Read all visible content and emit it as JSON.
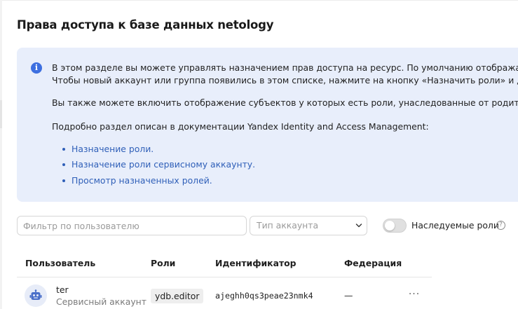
{
  "page": {
    "title": "Права доступа к базе данных netology"
  },
  "info": {
    "line1": "В этом разделе вы можете управлять назначением прав доступа на ресурс. По умолчанию отображается список",
    "line2": "Чтобы новый аккаунт или группа появились в этом списке, нажмите на кнопку «Назначить роли» и добавьте с",
    "line3": "Вы также можете включить отображение субъектов у которых есть роли, унаследованные от родительских ре",
    "line4": "Подробно раздел описан в документации Yandex Identity and Access Management:",
    "links": [
      "Назначение роли.",
      "Назначение роли сервисному аккаунту.",
      "Просмотр назначенных ролей."
    ]
  },
  "filters": {
    "user_placeholder": "Фильтр по пользователю",
    "account_type_placeholder": "Тип аккаунта",
    "inherited_label": "Наследуемые роли",
    "inherited_enabled": false
  },
  "table": {
    "columns": {
      "user": "Пользователь",
      "roles": "Роли",
      "identifier": "Идентификатор",
      "federation": "Федерация"
    },
    "rows": [
      {
        "name": "ter",
        "type": "Сервисный аккаунт",
        "role": "ydb.editor",
        "identifier": "ajeghh0qs3peae23nmk4",
        "federation": "—",
        "more": "···"
      }
    ]
  },
  "icons": {
    "info": "info-icon",
    "chevron": "chevron-down-icon",
    "help": "help-icon",
    "avatar": "robot-icon",
    "more": "more-icon"
  },
  "colors": {
    "info_background": "#e8eefb",
    "link": "#2f5fb8",
    "info_icon": "#3d6fe0"
  }
}
